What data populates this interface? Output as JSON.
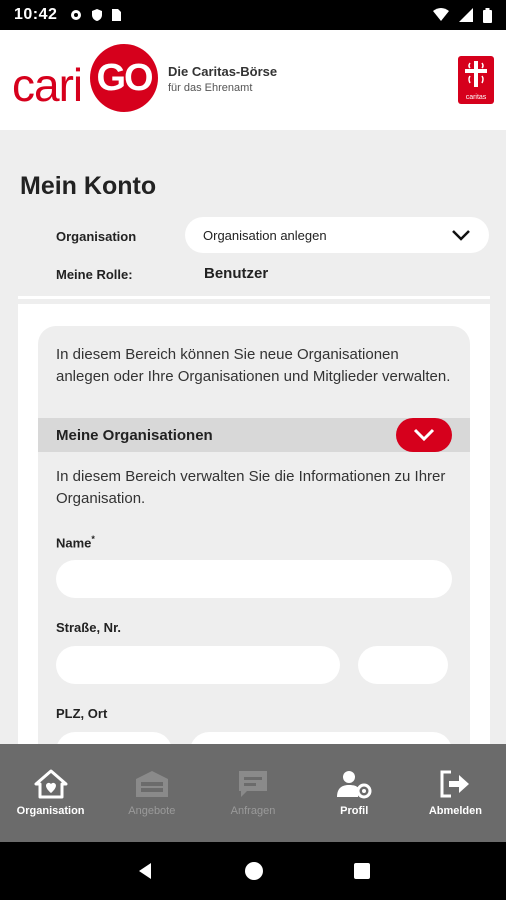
{
  "status_bar": {
    "time": "10:42"
  },
  "header": {
    "logo_cari": "cari",
    "logo_go": "GO",
    "tagline_title": "Die Caritas-Börse",
    "tagline_subtitle": "für das Ehrenamt",
    "caritas_logo_text": "caritas",
    "brand_color": "#d6001c"
  },
  "account": {
    "title": "Mein Konto",
    "organisation_label": "Organisation",
    "organisation_dropdown": "Organisation anlegen",
    "role_label": "Meine Rolle:",
    "role_value": "Benutzer"
  },
  "panel": {
    "intro": "In diesem Bereich können Sie neue Organisationen anlegen oder Ihre Organisationen und Mitglieder verwalten.",
    "section_title": "Meine Organisationen",
    "section_desc": "In diesem Bereich verwalten Sie die Informationen zu Ihrer Organisation.",
    "fields": {
      "name_label": "Name",
      "name_required": "*",
      "street_label": "Straße, Nr.",
      "zip_city_label": "PLZ, Ort"
    }
  },
  "bottom_nav": [
    {
      "label": "Organisation",
      "icon": "home-heart-icon",
      "enabled": true
    },
    {
      "label": "Angebote",
      "icon": "store-icon",
      "enabled": false
    },
    {
      "label": "Anfragen",
      "icon": "message-icon",
      "enabled": false
    },
    {
      "label": "Profil",
      "icon": "user-settings-icon",
      "enabled": true
    },
    {
      "label": "Abmelden",
      "icon": "logout-icon",
      "enabled": true
    }
  ]
}
